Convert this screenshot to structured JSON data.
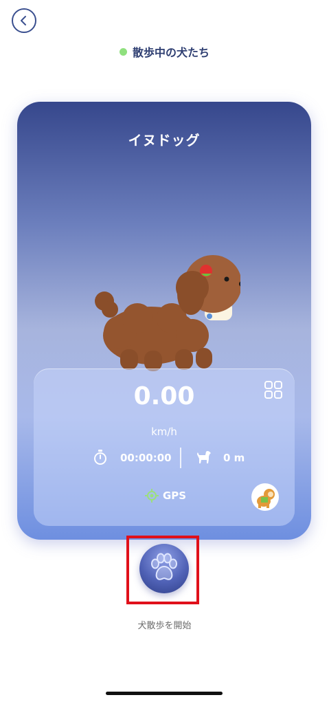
{
  "header": {
    "title": "散歩中の犬たち",
    "status_color": "#8fe07e"
  },
  "dog_card": {
    "dog_name": "イヌドッグ",
    "speed": "0.00",
    "speed_unit": "km/h",
    "elapsed_time": "00:00:00",
    "distance": "0 m",
    "gps_label": "GPS"
  },
  "actions": {
    "start_walk_label": "犬散歩を開始"
  },
  "icons": {
    "back": "chevron-left-icon",
    "grid": "grid-icon",
    "timer": "stopwatch-icon",
    "dog_walk": "dog-icon",
    "gps": "gps-target-icon",
    "paw": "paw-icon"
  },
  "colors": {
    "accent": "#36478c",
    "gps": "#9be07c",
    "highlight_border": "#e0101a"
  }
}
